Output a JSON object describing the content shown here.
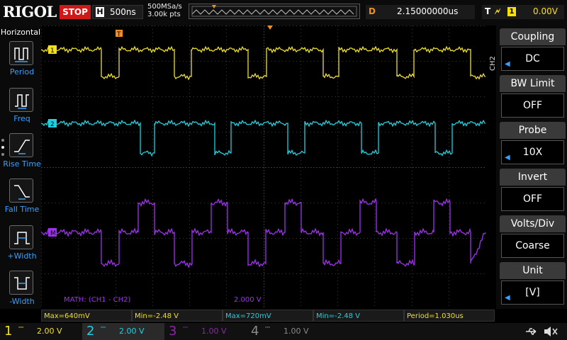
{
  "header": {
    "brand": "RIGOL",
    "run_state": "STOP",
    "timebase_badge": "H",
    "timebase": "500ns",
    "sample_rate": "500MSa/s",
    "memory_depth": "3.00k pts",
    "delay_badge": "D",
    "delay": "2.15000000us",
    "trigger_badge": "T",
    "trigger_source": "1",
    "trigger_level": "0.00V",
    "colors": {
      "stop": "#d01818",
      "delay": "#f09020"
    }
  },
  "left_menu": {
    "title": "Horizontal",
    "items": [
      {
        "label": "Period",
        "icon": "period-measure-icon"
      },
      {
        "label": "Freq",
        "icon": "frequency-measure-icon"
      },
      {
        "label": "Rise Time",
        "icon": "rise-time-icon"
      },
      {
        "label": "Fall Time",
        "icon": "fall-time-icon"
      },
      {
        "label": "+Width",
        "icon": "positive-width-icon"
      },
      {
        "label": "-Width",
        "icon": "negative-width-icon"
      }
    ]
  },
  "right_menu": {
    "channel_tag": "CH2",
    "items": [
      {
        "title": "Coupling",
        "value": "DC"
      },
      {
        "title": "BW Limit",
        "value": "OFF"
      },
      {
        "title": "Probe",
        "value": "10X"
      },
      {
        "title": "Invert",
        "value": "OFF"
      },
      {
        "title": "Volts/Div",
        "value": "Coarse"
      },
      {
        "title": "Unit",
        "value": "[V]"
      }
    ]
  },
  "waveforms": {
    "ch1_marker": "1",
    "ch2_marker": "2",
    "math_marker": "M",
    "math_label": "MATH: (CH1 - CH2)",
    "math_scale": "2.000 V",
    "trigger_marker": "T",
    "colors": {
      "ch1": "#f0e020",
      "ch2": "#20d0e0",
      "math": "#a030f0",
      "grid": "#3a3a3a"
    }
  },
  "measurements": [
    {
      "text": "Max=640mV",
      "color": "#f0e020"
    },
    {
      "text": "Min=-2.48 V",
      "color": "#f0e020"
    },
    {
      "text": "Max=720mV",
      "color": "#20d0e0"
    },
    {
      "text": "Min=-2.48 V",
      "color": "#20d0e0"
    },
    {
      "text": "Period=1.030us",
      "color": "#f0e020"
    }
  ],
  "channels": [
    {
      "num": "1",
      "coupling": "DC",
      "scale": "2.00 V",
      "color": "#f0e020",
      "active": true
    },
    {
      "num": "2",
      "coupling": "DC",
      "scale": "2.00 V",
      "color": "#20d0e0",
      "active": true
    },
    {
      "num": "3",
      "coupling": "DC",
      "scale": "1.00 V",
      "color": "#8a2aa0",
      "active": false
    },
    {
      "num": "4",
      "coupling": "DC",
      "scale": "1.00 V",
      "color": "#8a8a8a",
      "active": false
    }
  ]
}
